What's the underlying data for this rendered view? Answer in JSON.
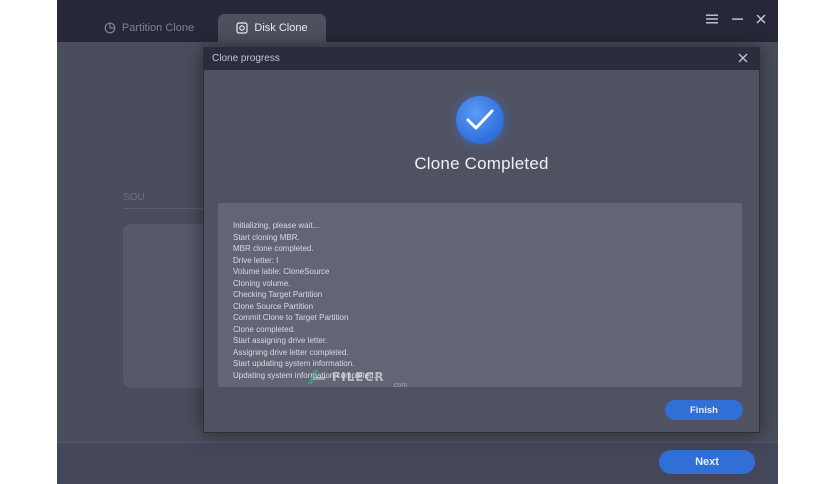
{
  "tabs": [
    {
      "label": "Partition Clone",
      "icon": "pie-chart-icon"
    },
    {
      "label": "Disk Clone",
      "icon": "disk-icon"
    }
  ],
  "window_controls": {
    "menu_icon": "menu-icon",
    "minimize_icon": "minimize-icon",
    "close_icon": "close-icon"
  },
  "background": {
    "section_label": "SOU"
  },
  "modal": {
    "title": "Clone progress",
    "close_icon": "close-icon",
    "status_icon": "check-circle-icon",
    "heading": "Clone Completed",
    "log": [
      "Initializing, please wait...",
      "Start cloning MBR.",
      "MBR clone completed.",
      "Drive letter: I",
      "Volume lable: CloneSource",
      "Cloning volume.",
      "Checking Target Partition",
      "Clone Source Partition",
      "Commit Clone to Target Partition",
      "Clone completed.",
      "Start assigning drive letter.",
      "Assigning drive letter completed.",
      "Start updating system information.",
      "Updating system information completed."
    ],
    "finish_label": "Finish"
  },
  "footer": {
    "next_label": "Next"
  },
  "watermark": {
    "text": "FILECR",
    "sub": ".com"
  },
  "colors": {
    "accent": "#2f6fd6",
    "titlebar": "#262839",
    "window_bg": "#4a4d5b",
    "log_bg": "#626575"
  }
}
